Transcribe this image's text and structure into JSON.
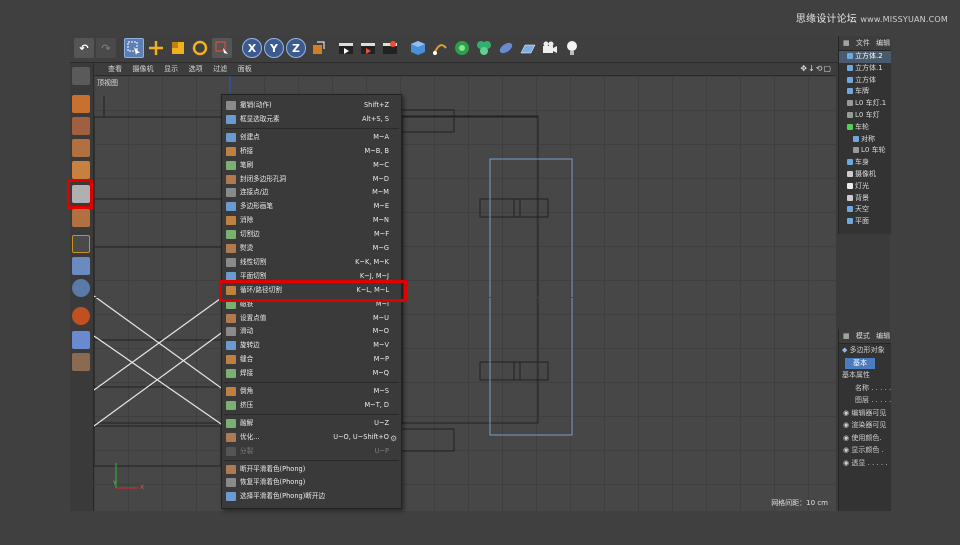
{
  "watermark": {
    "brand": "思缘设计论坛",
    "url": "www.MISSYUAN.COM"
  },
  "colors": {
    "highlight": "#e00000",
    "selection": "#4a5a6d",
    "accent_blue": "#4a7cc0",
    "axis_x": "#b01818",
    "axis_y": "#2a5cd0"
  },
  "toolbar_xyz": [
    "X",
    "Y",
    "Z"
  ],
  "viewport": {
    "menu": [
      "查看",
      "摄像机",
      "显示",
      "选项",
      "过滤",
      "面板"
    ],
    "label": "顶视图",
    "grid_info": "网格间距：10 cm",
    "axis_y": "Y",
    "axis_x": "X"
  },
  "object_panel": {
    "tabs": [
      "文件",
      "编辑"
    ],
    "items": [
      {
        "label": "立方体.2",
        "color": "#6fa8dc",
        "selected": true
      },
      {
        "label": "立方体.1",
        "color": "#6fa8dc",
        "selected": false
      },
      {
        "label": "立方体",
        "color": "#6fa8dc",
        "selected": false
      },
      {
        "label": "车牌",
        "color": "#6fa8dc",
        "selected": false
      },
      {
        "label": "L0 车灯.1",
        "color": "#9a9a9a",
        "selected": false
      },
      {
        "label": "L0 车灯",
        "color": "#9a9a9a",
        "selected": false
      },
      {
        "label": "车轮",
        "color": "#55cc55",
        "selected": false
      },
      {
        "label": "对称",
        "color": "#6fa8dc",
        "selected": false
      },
      {
        "label": "L0 车轮",
        "color": "#9a9a9a",
        "selected": false
      },
      {
        "label": "车身",
        "color": "#6fa8dc",
        "selected": false
      },
      {
        "label": "摄像机",
        "color": "#cccccc",
        "selected": false
      },
      {
        "label": "灯光",
        "color": "#eeeeee",
        "selected": false
      },
      {
        "label": "背景",
        "color": "#cccccc",
        "selected": false
      },
      {
        "label": "天空",
        "color": "#6fa8dc",
        "selected": false
      },
      {
        "label": "平面",
        "color": "#6fa8dc",
        "selected": false
      }
    ]
  },
  "attr_panel": {
    "tabs": [
      "模式",
      "编辑"
    ],
    "object": "多边形对象",
    "tab_basic": "基本",
    "section": "基本属性",
    "rows": [
      "名称 . . . . .",
      "图层 . . . . .",
      "编辑器可见",
      "渲染器可见",
      "使用颜色.",
      "显示颜色 .",
      "透显 . . . . ."
    ]
  },
  "context_menu": {
    "groups": [
      [
        {
          "label": "撤销(动作)",
          "shortcut": "Shift+Z",
          "disabled": false
        },
        {
          "label": "框显选取元素",
          "shortcut": "Alt+S, S",
          "disabled": false
        }
      ],
      [
        {
          "label": "创建点",
          "shortcut": "M~A",
          "disabled": false
        },
        {
          "label": "桥接",
          "shortcut": "M~B, B",
          "disabled": false
        },
        {
          "label": "笔刷",
          "shortcut": "M~C",
          "disabled": false
        },
        {
          "label": "封闭多边形孔洞",
          "shortcut": "M~D",
          "disabled": false
        },
        {
          "label": "连接点/边",
          "shortcut": "M~M",
          "disabled": false
        },
        {
          "label": "多边形画笔",
          "shortcut": "M~E",
          "disabled": false
        },
        {
          "label": "消除",
          "shortcut": "M~N",
          "disabled": false
        },
        {
          "label": "切割边",
          "shortcut": "M~F",
          "disabled": false
        },
        {
          "label": "熨烫",
          "shortcut": "M~G",
          "disabled": false
        },
        {
          "label": "线性切割",
          "shortcut": "K~K, M~K",
          "disabled": false
        },
        {
          "label": "平面切割",
          "shortcut": "K~J, M~J",
          "disabled": false
        },
        {
          "label": "循环/路径切割",
          "shortcut": "K~L, M~L",
          "disabled": false
        },
        {
          "label": "磁铁",
          "shortcut": "M~I",
          "disabled": false
        },
        {
          "label": "设置点值",
          "shortcut": "M~U",
          "disabled": false
        },
        {
          "label": "滑动",
          "shortcut": "M~O",
          "disabled": false
        },
        {
          "label": "旋转边",
          "shortcut": "M~V",
          "disabled": false
        },
        {
          "label": "缝合",
          "shortcut": "M~P",
          "disabled": false
        },
        {
          "label": "焊接",
          "shortcut": "M~Q",
          "disabled": false
        }
      ],
      [
        {
          "label": "倒角",
          "shortcut": "M~S",
          "disabled": false
        },
        {
          "label": "挤压",
          "shortcut": "M~T, D",
          "disabled": false
        }
      ],
      [
        {
          "label": "融解",
          "shortcut": "U~Z",
          "disabled": false
        },
        {
          "label": "优化...",
          "shortcut": "U~O, U~Shift+O",
          "disabled": false
        },
        {
          "label": "分裂",
          "shortcut": "U~P",
          "disabled": true
        }
      ],
      [
        {
          "label": "断开平滑着色(Phong)",
          "shortcut": "",
          "disabled": false
        },
        {
          "label": "恢复平滑着色(Phong)",
          "shortcut": "",
          "disabled": false
        },
        {
          "label": "选择平滑着色(Phong)断开边",
          "shortcut": "",
          "disabled": false
        }
      ]
    ]
  }
}
